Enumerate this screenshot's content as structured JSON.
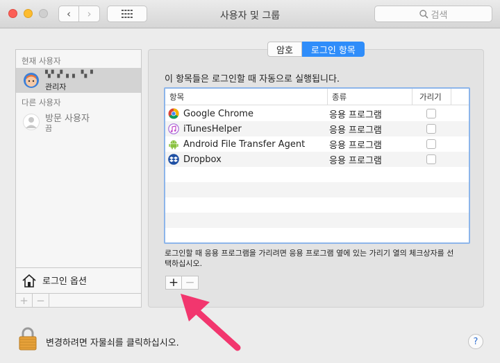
{
  "window": {
    "title": "사용자 및 그룹"
  },
  "toolbar": {
    "back_glyph": "‹",
    "forward_glyph": "›",
    "search_placeholder": "검색"
  },
  "sidebar": {
    "current_users_label": "현재 사용자",
    "current_user": {
      "name": "▚▘▞▗ ▖▝▖▘",
      "role": "관리자"
    },
    "other_users_label": "다른 사용자",
    "guest_user": {
      "name": "방문 사용자",
      "status": "끔"
    },
    "login_options_label": "로그인 옵션",
    "add_glyph": "+",
    "remove_glyph": "−"
  },
  "tabs": [
    {
      "label": "암호",
      "active": false
    },
    {
      "label": "로그인 항목",
      "active": true
    }
  ],
  "login_items": {
    "description": "이 항목들은 로그인할 때 자동으로 실행됩니다.",
    "columns": [
      "항목",
      "종류",
      "가리기"
    ],
    "rows": [
      {
        "name": "Google Chrome",
        "kind": "응용 프로그램",
        "hide": false,
        "icon": "chrome-icon"
      },
      {
        "name": "iTunesHelper",
        "kind": "응용 프로그램",
        "hide": false,
        "icon": "itunes-icon"
      },
      {
        "name": "Android File Transfer Agent",
        "kind": "응용 프로그램",
        "hide": false,
        "icon": "android-icon"
      },
      {
        "name": "Dropbox",
        "kind": "응용 프로그램",
        "hide": false,
        "icon": "dropbox-icon"
      }
    ],
    "hint": "로그인할 때 응용 프로그램을 가리려면 응용 프로그램 옆에 있는 가리기 열의 체크상자를 선택하십시오.",
    "add_glyph": "+",
    "remove_glyph": "−"
  },
  "footer": {
    "lock_text": "변경하려면 자물쇠를 클릭하십시오.",
    "help_glyph": "?"
  },
  "colors": {
    "accent": "#2f8dfa",
    "annotation_arrow": "#f2366e"
  }
}
